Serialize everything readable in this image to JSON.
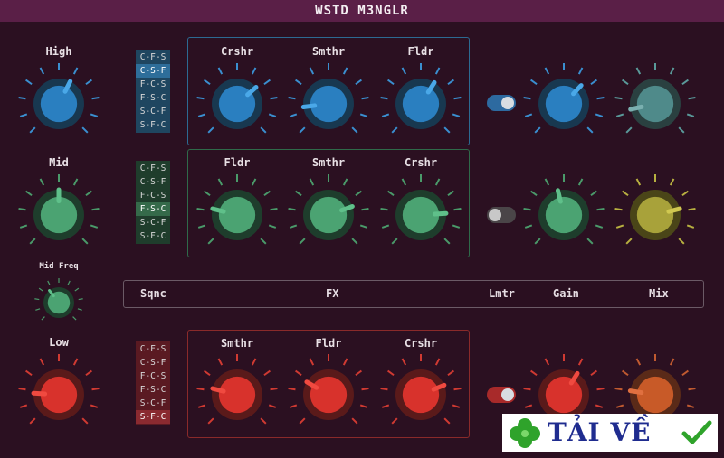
{
  "title": "WSTD M3NGLR",
  "colors": {
    "blue": "#2a7fc0",
    "green": "#4ba372",
    "red": "#d8322c",
    "teal": "#4f8a8a",
    "olive": "#a8a23a",
    "orange": "#c85a28"
  },
  "bands": {
    "high": {
      "label": "High",
      "order_options": [
        "C-F-S",
        "C-S-F",
        "F-C-S",
        "F-S-C",
        "S-C-F",
        "S-F-C"
      ],
      "order_selected": 1,
      "fx": [
        {
          "label": "Crshr",
          "value": 0.68
        },
        {
          "label": "Smthr",
          "value": 0.14
        },
        {
          "label": "Fldr",
          "value": 0.62
        }
      ],
      "band_value": 0.6,
      "gain_value": 0.66,
      "mix_value": 0.12,
      "limiter_on": true
    },
    "mid": {
      "label": "Mid",
      "order_options": [
        "C-F-S",
        "C-S-F",
        "F-C-S",
        "F-S-C",
        "S-C-F",
        "S-F-C"
      ],
      "order_selected": 3,
      "fx": [
        {
          "label": "Fldr",
          "value": 0.22
        },
        {
          "label": "Smthr",
          "value": 0.76
        },
        {
          "label": "Crshr",
          "value": 0.82
        }
      ],
      "band_value": 0.5,
      "gain_value": 0.45,
      "mix_value": 0.78,
      "limiter_on": false,
      "freq_label": "Mid Freq",
      "freq_value": 0.36
    },
    "low": {
      "label": "Low",
      "order_options": [
        "C-F-S",
        "C-S-F",
        "F-C-S",
        "F-S-C",
        "S-C-F",
        "S-F-C"
      ],
      "order_selected": 5,
      "fx": [
        {
          "label": "Smthr",
          "value": 0.22
        },
        {
          "label": "Fldr",
          "value": 0.28
        },
        {
          "label": "Crshr",
          "value": 0.75
        }
      ],
      "band_value": 0.18,
      "gain_value": 0.62,
      "mix_value": 0.2,
      "limiter_on": true
    }
  },
  "fx_bar": {
    "sqnc": "Sqnc",
    "fx": "FX",
    "lmtr": "Lmtr",
    "gain": "Gain",
    "mix": "Mix"
  },
  "ad": {
    "text": "TẢI VỀ",
    "icons": [
      "clover-icon",
      "checkmark-icon"
    ]
  }
}
